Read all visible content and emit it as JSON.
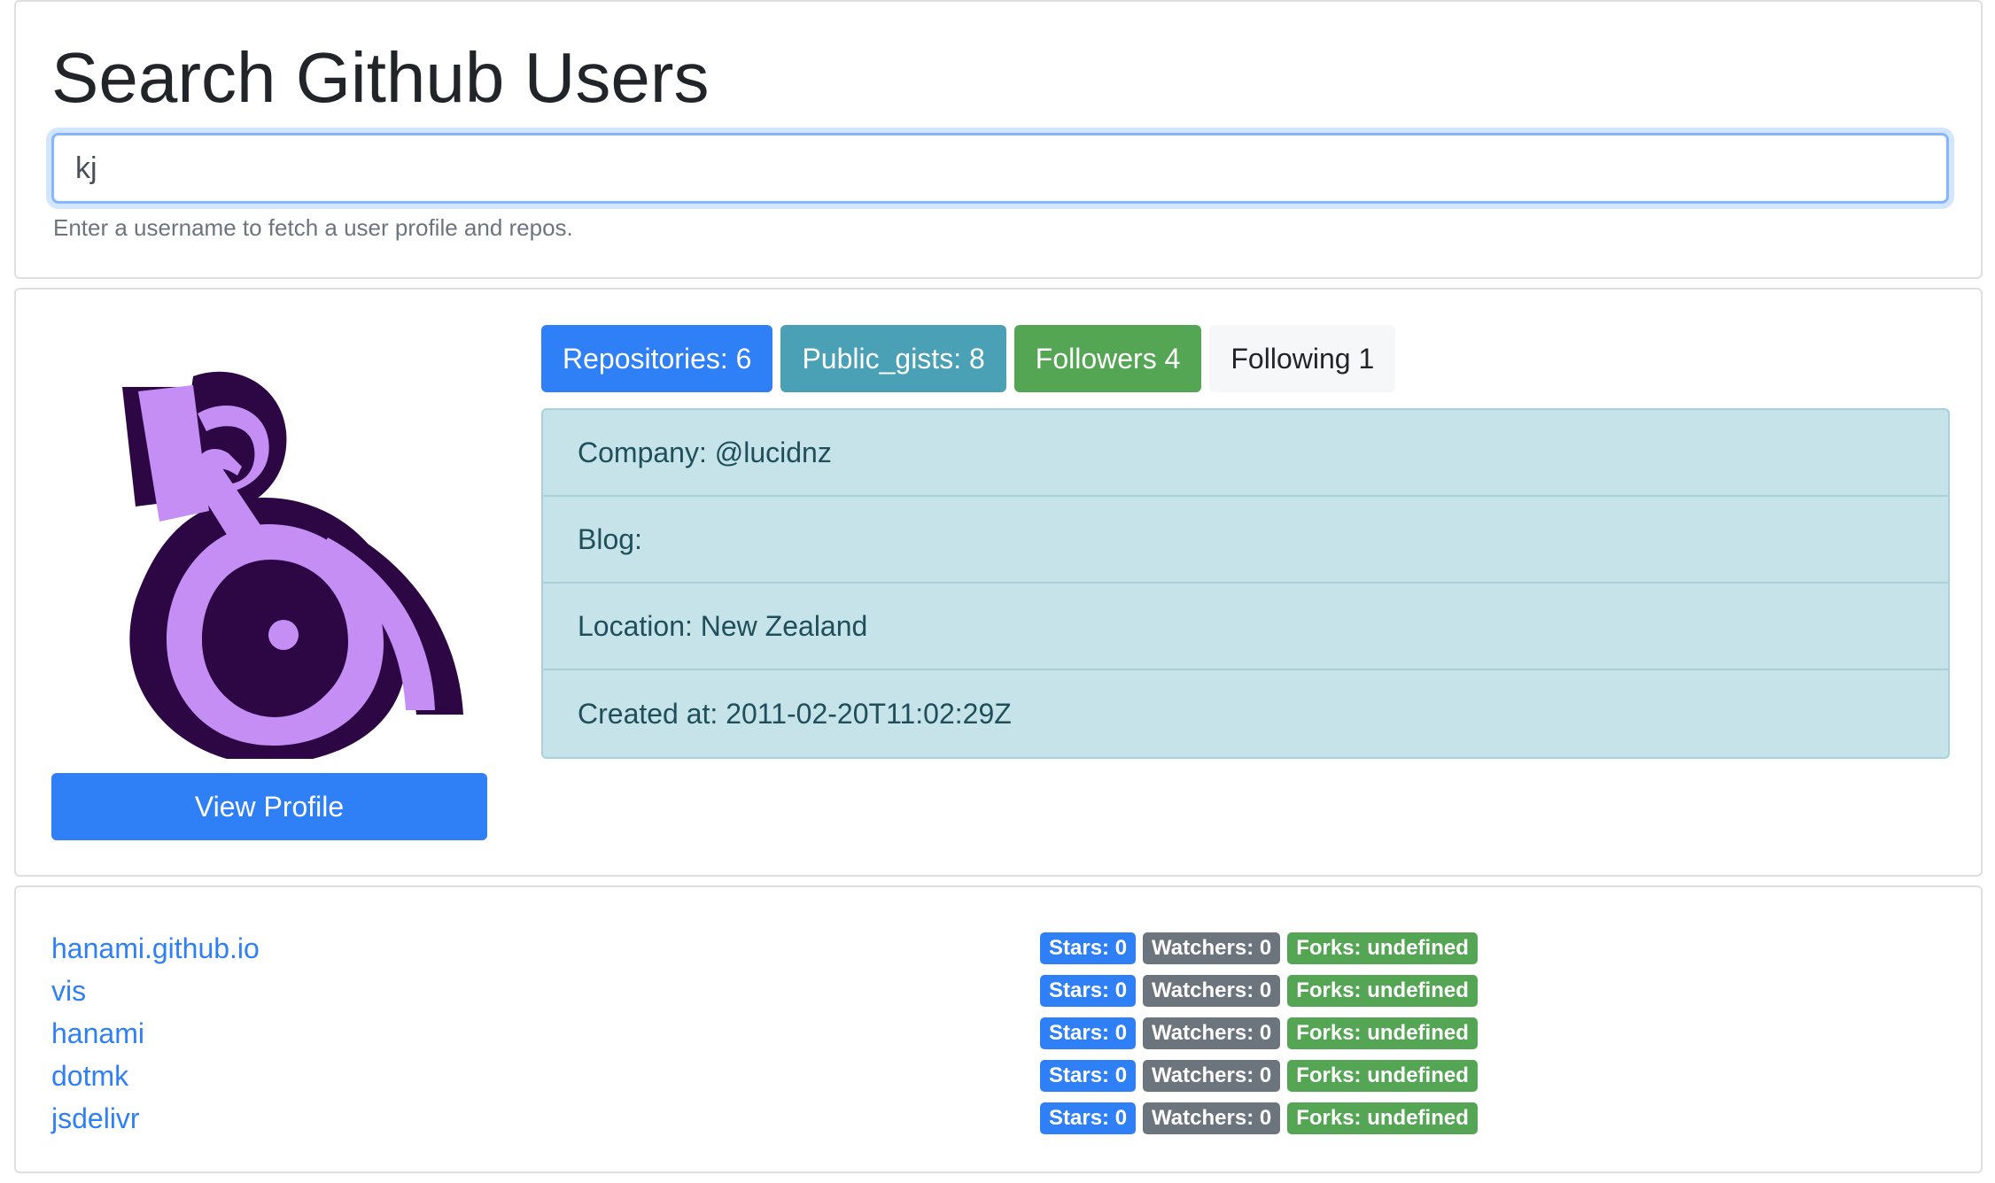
{
  "search": {
    "title": "Search Github Users",
    "value": "kj",
    "help": "Enter a username to fetch a user profile and repos."
  },
  "profile": {
    "view_profile_label": "View Profile",
    "badges": {
      "repositories": "Repositories: 6",
      "public_gists": "Public_gists: 8",
      "followers": "Followers 4",
      "following": "Following 1"
    },
    "info": {
      "company": "Company: @lucidnz",
      "blog": "Blog:",
      "location": "Location: New Zealand",
      "created": "Created at: 2011-02-20T11:02:29Z"
    },
    "avatar_colors": {
      "dark": "#2c0744",
      "light": "#c58ef5"
    }
  },
  "repos": [
    {
      "name": "hanami.github.io",
      "stars": "Stars: 0",
      "watchers": "Watchers: 0",
      "forks": "Forks: undefined"
    },
    {
      "name": "vis",
      "stars": "Stars: 0",
      "watchers": "Watchers: 0",
      "forks": "Forks: undefined"
    },
    {
      "name": "hanami",
      "stars": "Stars: 0",
      "watchers": "Watchers: 0",
      "forks": "Forks: undefined"
    },
    {
      "name": "dotmk",
      "stars": "Stars: 0",
      "watchers": "Watchers: 0",
      "forks": "Forks: undefined"
    },
    {
      "name": "jsdelivr",
      "stars": "Stars: 0",
      "watchers": "Watchers: 0",
      "forks": "Forks: undefined"
    }
  ]
}
